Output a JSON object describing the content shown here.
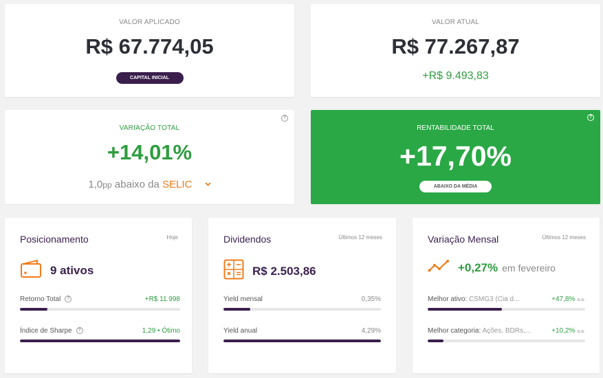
{
  "top": {
    "valor_aplicado": {
      "label": "VALOR APLICADO",
      "value": "R$ 67.774,05",
      "pill": "CAPITAL INICIAL"
    },
    "valor_atual": {
      "label": "VALOR ATUAL",
      "value": "R$ 77.267,87",
      "delta": "+R$ 9.493,83"
    }
  },
  "middle": {
    "variacao": {
      "label": "VARIAÇÃO TOTAL",
      "value": "+14,01%",
      "sub_prefix": "1,0",
      "sub_unit": "pp",
      "sub_text": " abaixo da ",
      "benchmark": "SELIC",
      "help": "?"
    },
    "rentabilidade": {
      "label": "RENTABILIDADE TOTAL",
      "value": "+17,70%",
      "pill": "ABAIXO DA MÉDIA",
      "help": "?",
      "bg": "#2aa845"
    }
  },
  "cards": {
    "posicionamento": {
      "title": "Posicionamento",
      "period": "Hoje",
      "headline": "9 ativos",
      "m1_label": "Retorno Total",
      "m1_value": "+R$ 11.998",
      "m1_fill": 0.17,
      "m2_label": "Índice de Sharpe",
      "m2_value": "1,29 • Ótimo",
      "m2_fill": 1.0,
      "help": "?"
    },
    "dividendos": {
      "title": "Dividendos",
      "period": "Últimos 12 meses",
      "headline": "R$ 2.503,86",
      "m1_label": "Yield mensal",
      "m1_value": "0,35%",
      "m1_fill": 0.17,
      "m2_label": "Yield anual",
      "m2_value": "4,29%",
      "m2_fill": 1.0
    },
    "variacao_mensal": {
      "title": "Variação Mensal",
      "period": "Últimos 12 meses",
      "headline_value": "+0,27%",
      "headline_suffix": "em fevereiro",
      "m1_label": "Melhor ativo:",
      "m1_detail": "CSMG3 (Cia d...",
      "m1_value": "+47,8%",
      "m1_unit": "a.a.",
      "m1_fill": 0.47,
      "m2_label": "Melhor categoria:",
      "m2_detail": "Ações, BDRs,...",
      "m2_value": "+10,2%",
      "m2_unit": "a.a.",
      "m2_fill": 0.1
    }
  },
  "colors": {
    "accent": "#3a1f4d",
    "positive": "#2e9d3f",
    "orange": "#f07c1b"
  },
  "icons": {
    "wallet": "wallet-icon",
    "calculator": "calculator-icon",
    "trend": "trend-up-icon",
    "chevron": "chevron-down-icon"
  }
}
